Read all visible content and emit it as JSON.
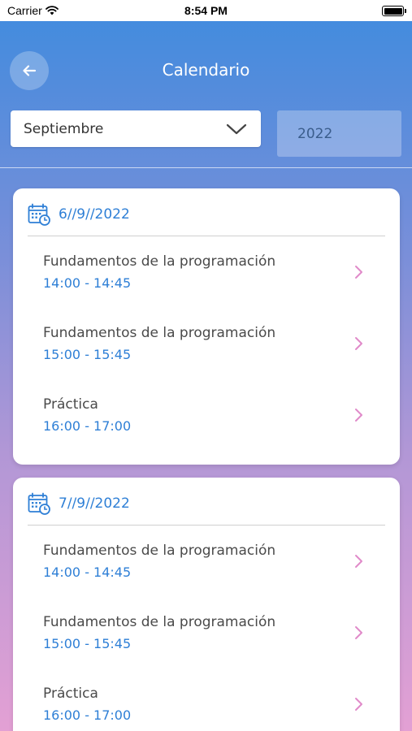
{
  "status_bar": {
    "carrier": "Carrier",
    "time": "8:54 PM"
  },
  "header": {
    "title": "Calendario"
  },
  "filters": {
    "month": "Septiembre",
    "year": "2022"
  },
  "days": [
    {
      "date": "6//9//2022",
      "sessions": [
        {
          "title": "Fundamentos de la programación",
          "time": "14:00 - 14:45"
        },
        {
          "title": "Fundamentos de la programación",
          "time": "15:00 - 15:45"
        },
        {
          "title": "Práctica",
          "time": "16:00 - 17:00"
        }
      ]
    },
    {
      "date": "7//9//2022",
      "sessions": [
        {
          "title": "Fundamentos de la programación",
          "time": "14:00 - 14:45"
        },
        {
          "title": "Fundamentos de la programación",
          "time": "15:00 - 15:45"
        },
        {
          "title": "Práctica",
          "time": "16:00 - 17:00"
        }
      ]
    }
  ],
  "colors": {
    "accent_blue": "#2e7fd6",
    "chevron_pink": "#e08ac9",
    "gradient_top": "#3f8bde",
    "gradient_bottom": "#e3a0d4"
  }
}
